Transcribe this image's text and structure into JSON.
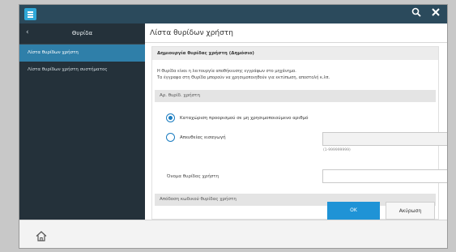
{
  "window": {
    "search_icon": "search-icon",
    "close_icon": "close-icon"
  },
  "sidebar": {
    "back": "‹",
    "title": "Θυρίδα",
    "items": [
      {
        "label": "Λίστα θυρίδων χρήστη",
        "active": true
      },
      {
        "label": "Λίστα θυρίδων χρήστη συστήματος",
        "active": false
      }
    ]
  },
  "main": {
    "title": "Λίστα θυρίδων χρήστη",
    "panel_title": "Δημιουργία θυρίδας χρήστη (Δημόσιο)",
    "description": [
      "Η Θυρίδα είναι η λειτουργία αποθήκευσης εγγράφων στο μηχάνημα.",
      "Τα έγγραφα στη Θυρίδα μπορούν να χρησιμοποιηθούν για εκτύπωση, αποστολή κ.λπ."
    ],
    "box_number_label": "Αρ. θυρίδ. χρήστη",
    "option_auto": "Καταχώριση προορισμού σε μη χρησιμοποιούμενο αριθμό",
    "option_direct": "Απευθείας εισαγωγή",
    "direct_input_value": "",
    "direct_input_hint": "(1-999999999)",
    "box_name_label": "Όνομα θυρίδας χρήστη",
    "box_name_value": "",
    "password_section": "Απόδοση κωδικού θυρίδας χρήστη"
  },
  "buttons": {
    "ok": "OK",
    "cancel": "Ακύρωση"
  },
  "footer": {
    "home_icon": "home-icon"
  },
  "colors": {
    "topbar": "#2b4a5c",
    "sidebar": "#24313a",
    "accent": "#1f93d6"
  }
}
